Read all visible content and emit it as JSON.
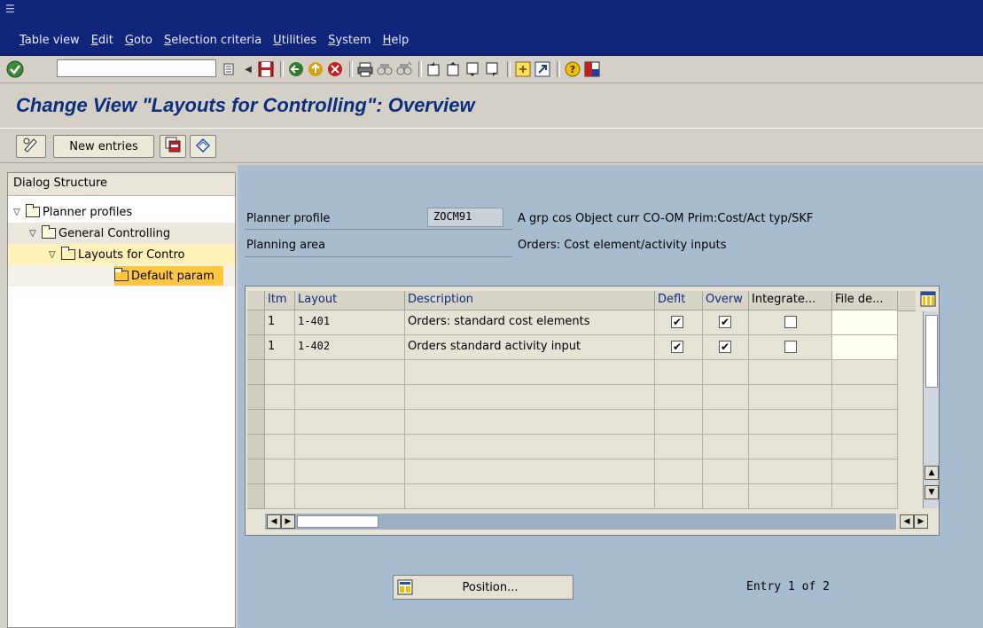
{
  "menu": {
    "items": [
      {
        "u": "T",
        "rest": "able view"
      },
      {
        "u": "E",
        "rest": "dit"
      },
      {
        "u": "G",
        "rest": "oto"
      },
      {
        "u": "S",
        "rest": "election criteria"
      },
      {
        "u": "U",
        "rest": "tilities"
      },
      {
        "u": "S",
        "rest": "ystem"
      },
      {
        "u": "H",
        "rest": "elp"
      }
    ]
  },
  "toolbar": {
    "command_value": "",
    "icons": [
      "enter-icon",
      "back-icon",
      "exit-icon",
      "cancel-icon",
      "print-icon",
      "find-icon",
      "find-next-icon",
      "first-page-icon",
      "previous-page-icon",
      "next-page-icon",
      "last-page-icon",
      "create-session-icon",
      "shortcut-icon",
      "help-icon",
      "layout-menu-icon"
    ]
  },
  "title": "Change View \"Layouts for Controlling\": Overview",
  "app_toolbar": {
    "new_entries_label": "New entries"
  },
  "dialog_structure": {
    "header": "Dialog Structure",
    "nodes": [
      {
        "label": "Planner profiles"
      },
      {
        "label": "General Controlling"
      },
      {
        "label": "Layouts for Contro"
      },
      {
        "label": "Default param"
      }
    ]
  },
  "header_fields": {
    "planner_profile_label": "Planner profile",
    "planner_profile_value": "ZOCM91",
    "planner_profile_desc": "A grp cos Object curr CO-OM Prim:Cost/Act typ/SKF",
    "planning_area_label": "Planning area",
    "planning_area_desc": "Orders: Cost element/activity inputs"
  },
  "table": {
    "columns": [
      "Itm",
      "Layout",
      "Description",
      "Deflt",
      "Overw",
      "Integrate...",
      "File de..."
    ],
    "rows": [
      {
        "itm": "1",
        "layout": "1-401",
        "description": "Orders: standard cost elements",
        "deflt": true,
        "overw": true,
        "integrate": false,
        "file": ""
      },
      {
        "itm": "1",
        "layout": "1-402",
        "description": "Orders standard activity input",
        "deflt": true,
        "overw": true,
        "integrate": false,
        "file": ""
      }
    ],
    "empty_rows": 6
  },
  "footer": {
    "position_label": "Position...",
    "entry_text": "Entry 1 of 2"
  },
  "colors": {
    "menubar": "#10247a",
    "title": "#0d2d7d",
    "pane": "#a8bcd0",
    "highlight": "#fff1b8",
    "selected": "#ffc640"
  }
}
